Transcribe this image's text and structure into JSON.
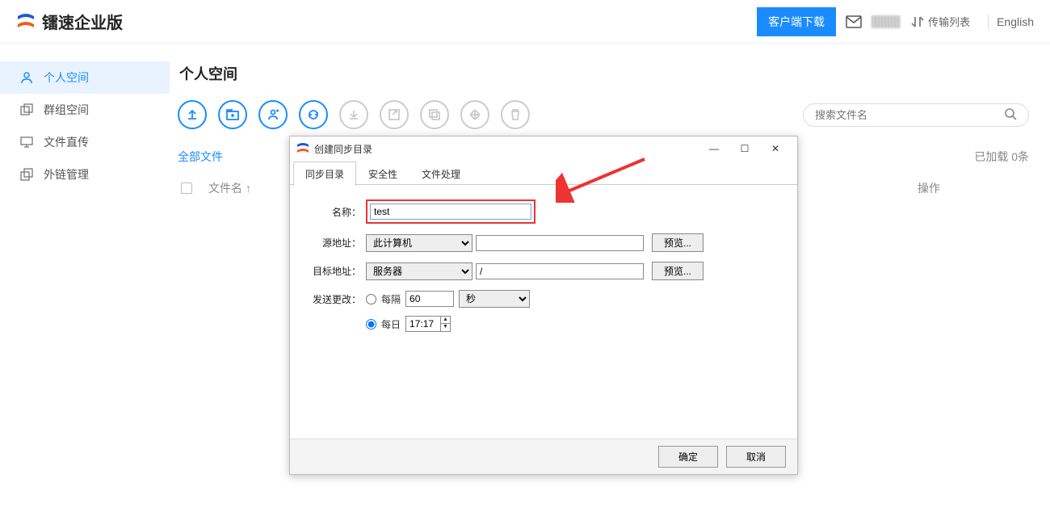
{
  "topbar": {
    "brand": "镭速企业版",
    "download": "客户端下载",
    "transfer_list": "传输列表",
    "language": "English"
  },
  "sidebar": {
    "items": [
      {
        "label": "个人空间"
      },
      {
        "label": "群组空间"
      },
      {
        "label": "文件直传"
      },
      {
        "label": "外链管理"
      }
    ]
  },
  "page": {
    "title": "个人空间",
    "all_files": "全部文件",
    "loaded": "已加载 0条",
    "col_name": "文件名",
    "col_op": "操作",
    "search_placeholder": "搜索文件名"
  },
  "dialog": {
    "title": "创建同步目录",
    "tabs": [
      "同步目录",
      "安全性",
      "文件处理"
    ],
    "labels": {
      "name": "名称：",
      "source": "源地址：",
      "target": "目标地址：",
      "send_change": "发送更改："
    },
    "name_value": "test",
    "source_select": "此计算机",
    "source_path": "",
    "target_select": "服务器",
    "target_path": "/",
    "preview": "预览...",
    "interval_label": "每隔",
    "interval_value": "60",
    "interval_unit": "秒",
    "daily_label": "每日",
    "daily_time": "17:17",
    "radio_selected": "daily",
    "ok": "确定",
    "cancel": "取消"
  }
}
